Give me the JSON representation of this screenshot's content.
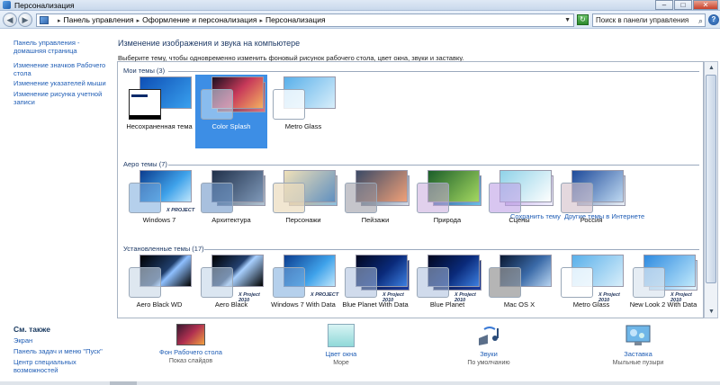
{
  "window": {
    "title": "Персонализация"
  },
  "address": {
    "crumbs": [
      "Панель управления",
      "Оформление и персонализация",
      "Персонализация"
    ],
    "search_placeholder": "Поиск в панели управления"
  },
  "sidebar": {
    "links": [
      "Панель управления - домашняя страница",
      "Изменение значков Рабочего стола",
      "Изменение указателей мыши",
      "Изменение рисунка учетной записи"
    ],
    "see_also_title": "См. также",
    "see_also": [
      "Экран",
      "Панель задач и меню \"Пуск\"",
      "Центр специальных возможностей"
    ]
  },
  "main": {
    "title": "Изменение изображения и звука на компьютере",
    "subtitle": "Выберите тему, чтобы одновременно изменить фоновый рисунок рабочего стола, цвет окна, звуки и заставку.",
    "save_theme": "Сохранить тему",
    "more_themes": "Другие темы в Интернете"
  },
  "groups": [
    {
      "title": "Мои темы (3)",
      "themes": [
        {
          "label": "Несохраненная тема",
          "style": "unsaved"
        },
        {
          "label": "Color Splash",
          "style": "splash",
          "selected": true
        },
        {
          "label": "Metro Glass",
          "style": "metro"
        }
      ]
    },
    {
      "title": "Аеро темы (7)",
      "themes": [
        {
          "label": "Windows 7",
          "style": "win7",
          "badge": "X PROJECT"
        },
        {
          "label": "Архитектура",
          "style": "arch"
        },
        {
          "label": "Персонажи",
          "style": "chars"
        },
        {
          "label": "Пейзажи",
          "style": "land"
        },
        {
          "label": "Природа",
          "style": "nature"
        },
        {
          "label": "Сцены",
          "style": "scenes"
        },
        {
          "label": "Россия",
          "style": "russia"
        }
      ]
    },
    {
      "title": "Установленные темы (17)",
      "themes": [
        {
          "label": "Aero Black WD",
          "style": "black"
        },
        {
          "label": "Aero Black",
          "style": "black2",
          "badge": "X Project 2010"
        },
        {
          "label": "Windows 7 With Data",
          "style": "win7",
          "badge": "X PROJECT"
        },
        {
          "label": "Blue Planet With Data",
          "style": "planet",
          "badge": "X Project 2010"
        },
        {
          "label": "Blue Planet",
          "style": "planet",
          "badge": "X Project 2010"
        },
        {
          "label": "Mac OS X",
          "style": "mac"
        },
        {
          "label": "Metro Glass",
          "style": "metro",
          "badge": "X Project 2010"
        },
        {
          "label": "New Look 2 With Data",
          "style": "newlook",
          "badge": "X Project 2010"
        }
      ]
    }
  ],
  "bottom": [
    {
      "label": "Фон Рабочего стола",
      "sub": "Показ слайдов",
      "icon": "wallpaper-icon"
    },
    {
      "label": "Цвет окна",
      "sub": "Море",
      "icon": "window-color-icon"
    },
    {
      "label": "Звуки",
      "sub": "По умолчанию",
      "icon": "sounds-icon"
    },
    {
      "label": "Заставка",
      "sub": "Мыльные пузыри",
      "icon": "screensaver-icon"
    }
  ]
}
